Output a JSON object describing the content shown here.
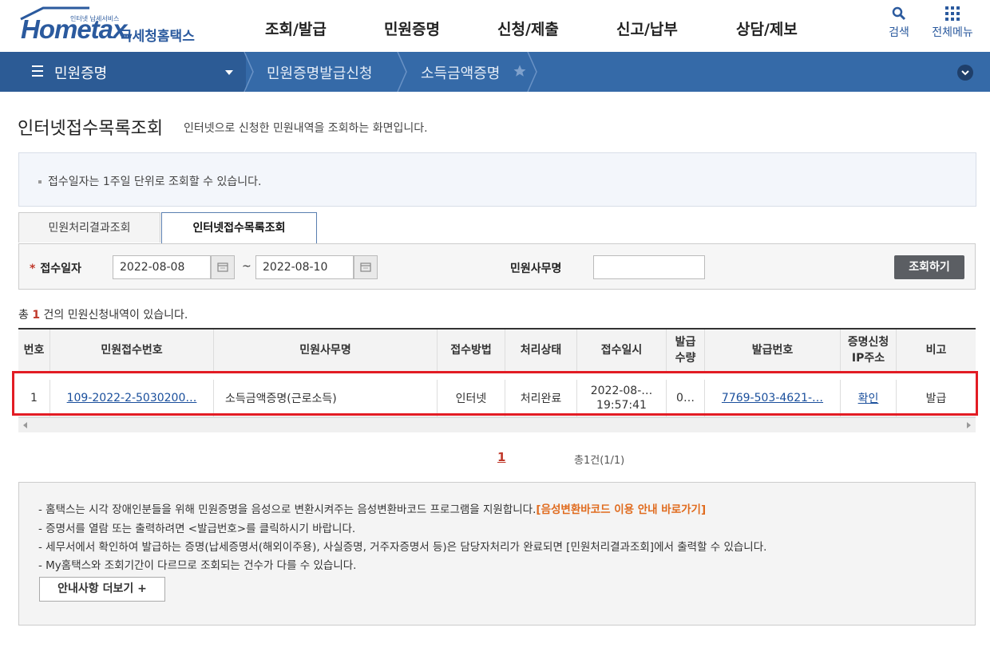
{
  "header": {
    "logo_text": "Hometax.",
    "logo_tagline": "인터넷 납세서비스",
    "logo_korean": "국세청홈택스",
    "nav": [
      "조회/발급",
      "민원증명",
      "신청/제출",
      "신고/납부",
      "상담/제보"
    ],
    "search_label": "검색",
    "allmenu_label": "전체메뉴"
  },
  "location": {
    "menu": "민원증명",
    "crumb1": "민원증명발급신청",
    "crumb2": "소득금액증명"
  },
  "page": {
    "title": "인터넷접수목록조회",
    "description": "인터넷으로 신청한 민원내역을 조회하는 화면입니다.",
    "notice": "접수일자는 1주일 단위로 조회할 수 있습니다."
  },
  "tabs": [
    "민원처리결과조회",
    "인터넷접수목록조회"
  ],
  "search": {
    "date_label": "접수일자",
    "date_from": "2022-08-08",
    "date_to": "2022-08-10",
    "tilde": "~",
    "office_label": "민원사무명",
    "office_value": "",
    "button": "조회하기"
  },
  "result": {
    "prefix": "총",
    "count": "1",
    "suffix": "건의 민원신청내역이 있습니다."
  },
  "table": {
    "headers": [
      "번호",
      "민원접수번호",
      "민원사무명",
      "접수방법",
      "처리상태",
      "접수일시",
      "발급\n수량",
      "발급번호",
      "증명신청\nIP주소",
      "비고"
    ],
    "rows": [
      {
        "no": "1",
        "receipt_no": "109-2022-2-5030200…",
        "office": "소득금액증명(근로소득)",
        "method": "인터넷",
        "status": "처리완료",
        "date_line1": "2022-08-…",
        "date_line2": "19:57:41",
        "qty": "0…",
        "issue_no": "7769-503-4621-…",
        "ip_link": "확인",
        "remark": "발급"
      }
    ]
  },
  "pager": {
    "current": "1",
    "total": "총1건(1/1)"
  },
  "guide": {
    "line1": "- 홈택스는 시각 장애인분들을 위해 민원증명을 음성으로 변환시켜주는 음성변환바코드 프로그램을 지원합니다.",
    "line1_link": "[음성변환바코드 이용 안내 바로가기]",
    "line2": "- 증명서를 열람 또는 출력하려면 <발급번호>를 클릭하시기 바랍니다.",
    "line3": "- 세무서에서 확인하여 발급하는 증명(납세증명서(해외이주용), 사실증명, 거주자증명서 등)은 담당자처리가 완료되면 [민원처리결과조회]에서 출력할 수 있습니다.",
    "line4": "- My홈택스와 조회기간이 다르므로 조회되는 건수가 다를 수 있습니다.",
    "more_button": "안내사항 더보기 +"
  },
  "colors": {
    "brand_blue": "#2b5a9e",
    "locbar": "#356aa8",
    "highlight": "#e21c24",
    "accent_red": "#c0392b",
    "guide_orange": "#e06b1e"
  }
}
